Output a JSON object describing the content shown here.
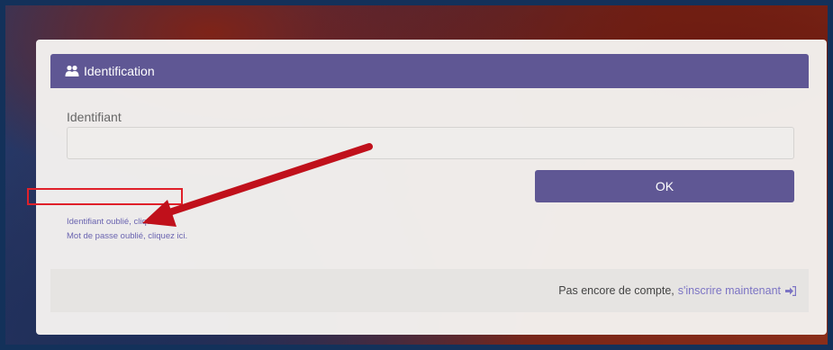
{
  "card": {
    "title": "Identification",
    "title_icon": "users-icon"
  },
  "form": {
    "field_label": "Identifiant",
    "field_value": "",
    "field_placeholder": "",
    "submit_label": "OK"
  },
  "links": {
    "forgot_username": "Identifiant oublié, cliquez ici.",
    "forgot_password": "Mot de passe oublié, cliquez ici."
  },
  "footer": {
    "text": "Pas encore de compte,",
    "signup_label": "s'inscrire maintenant",
    "signup_icon": "login-icon"
  },
  "colors": {
    "accent": "#5f5794",
    "link": "#6a64b0",
    "annotation": "#c0101b",
    "frame_border": "#13315a"
  }
}
